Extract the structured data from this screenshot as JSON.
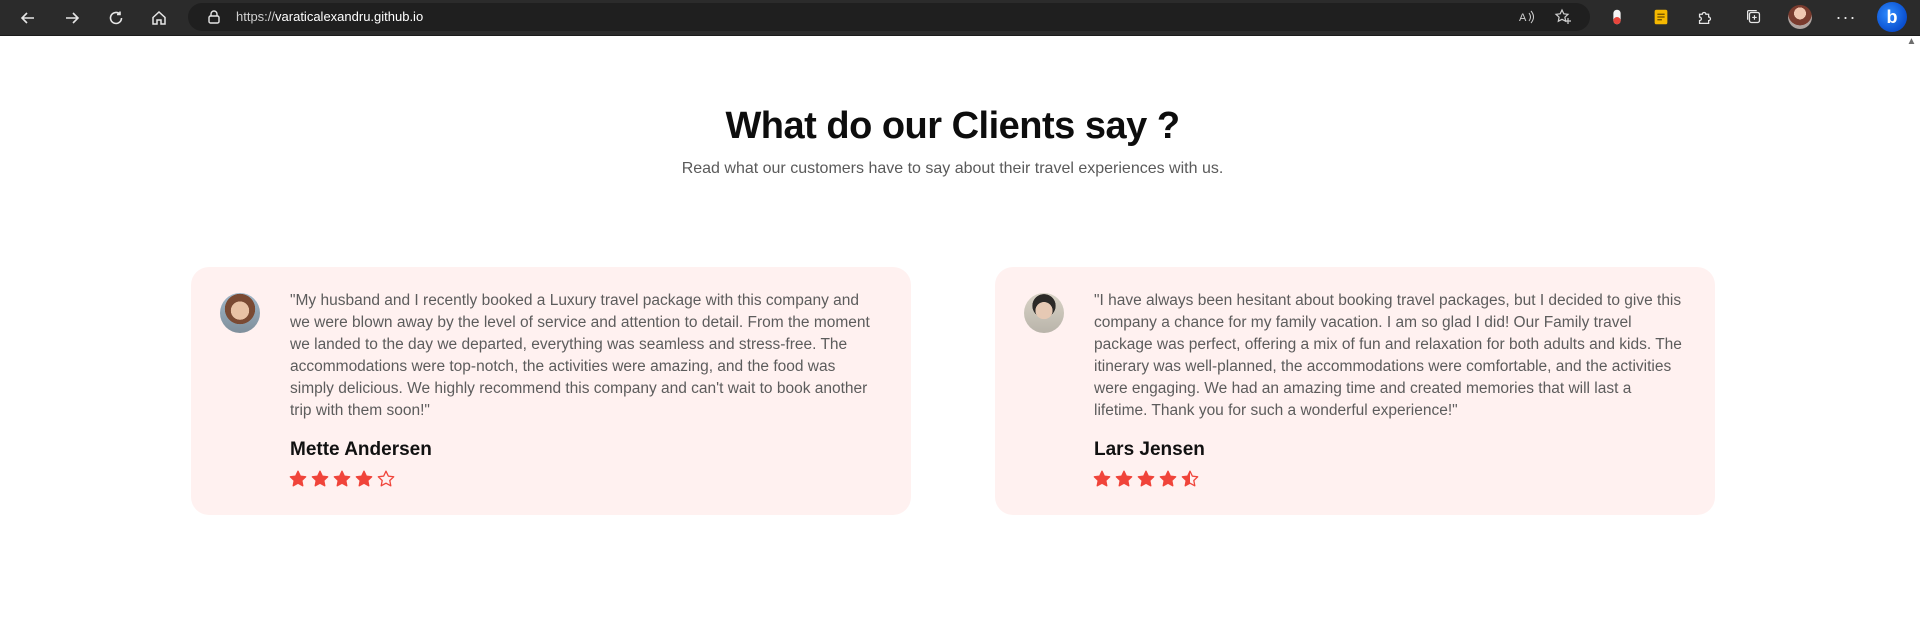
{
  "browser": {
    "url_scheme": "https://",
    "url_host": "varaticalexandru.github.io"
  },
  "section": {
    "title": "What do our Clients say ?",
    "subtitle": "Read what our customers have to say about their travel experiences with us."
  },
  "testimonials": [
    {
      "quote": "\"My husband and I recently booked a Luxury travel package with this company and we were blown away by the level of service and attention to detail. From the moment we landed to the day we departed, everything was seamless and stress-free. The accommodations were top-notch, the activities were amazing, and the food was simply delicious. We highly recommend this company and can't wait to book another trip with them soon!\"",
      "name": "Mette Andersen",
      "rating": 4,
      "max_rating": 5
    },
    {
      "quote": "\"I have always been hesitant about booking travel packages, but I decided to give this company a chance for my family vacation. I am so glad I did! Our Family travel package was perfect, offering a mix of fun and relaxation for both adults and kids. The itinerary was well-planned, the accommodations were comfortable, and the activities were engaging. We had an amazing time and created memories that will last a lifetime. Thank you for such a wonderful experience!\"",
      "name": "Lars Jensen",
      "rating": 4.5,
      "max_rating": 5
    }
  ],
  "colors": {
    "accent_star": "#f0443a",
    "card_bg": "#fff1f0"
  }
}
